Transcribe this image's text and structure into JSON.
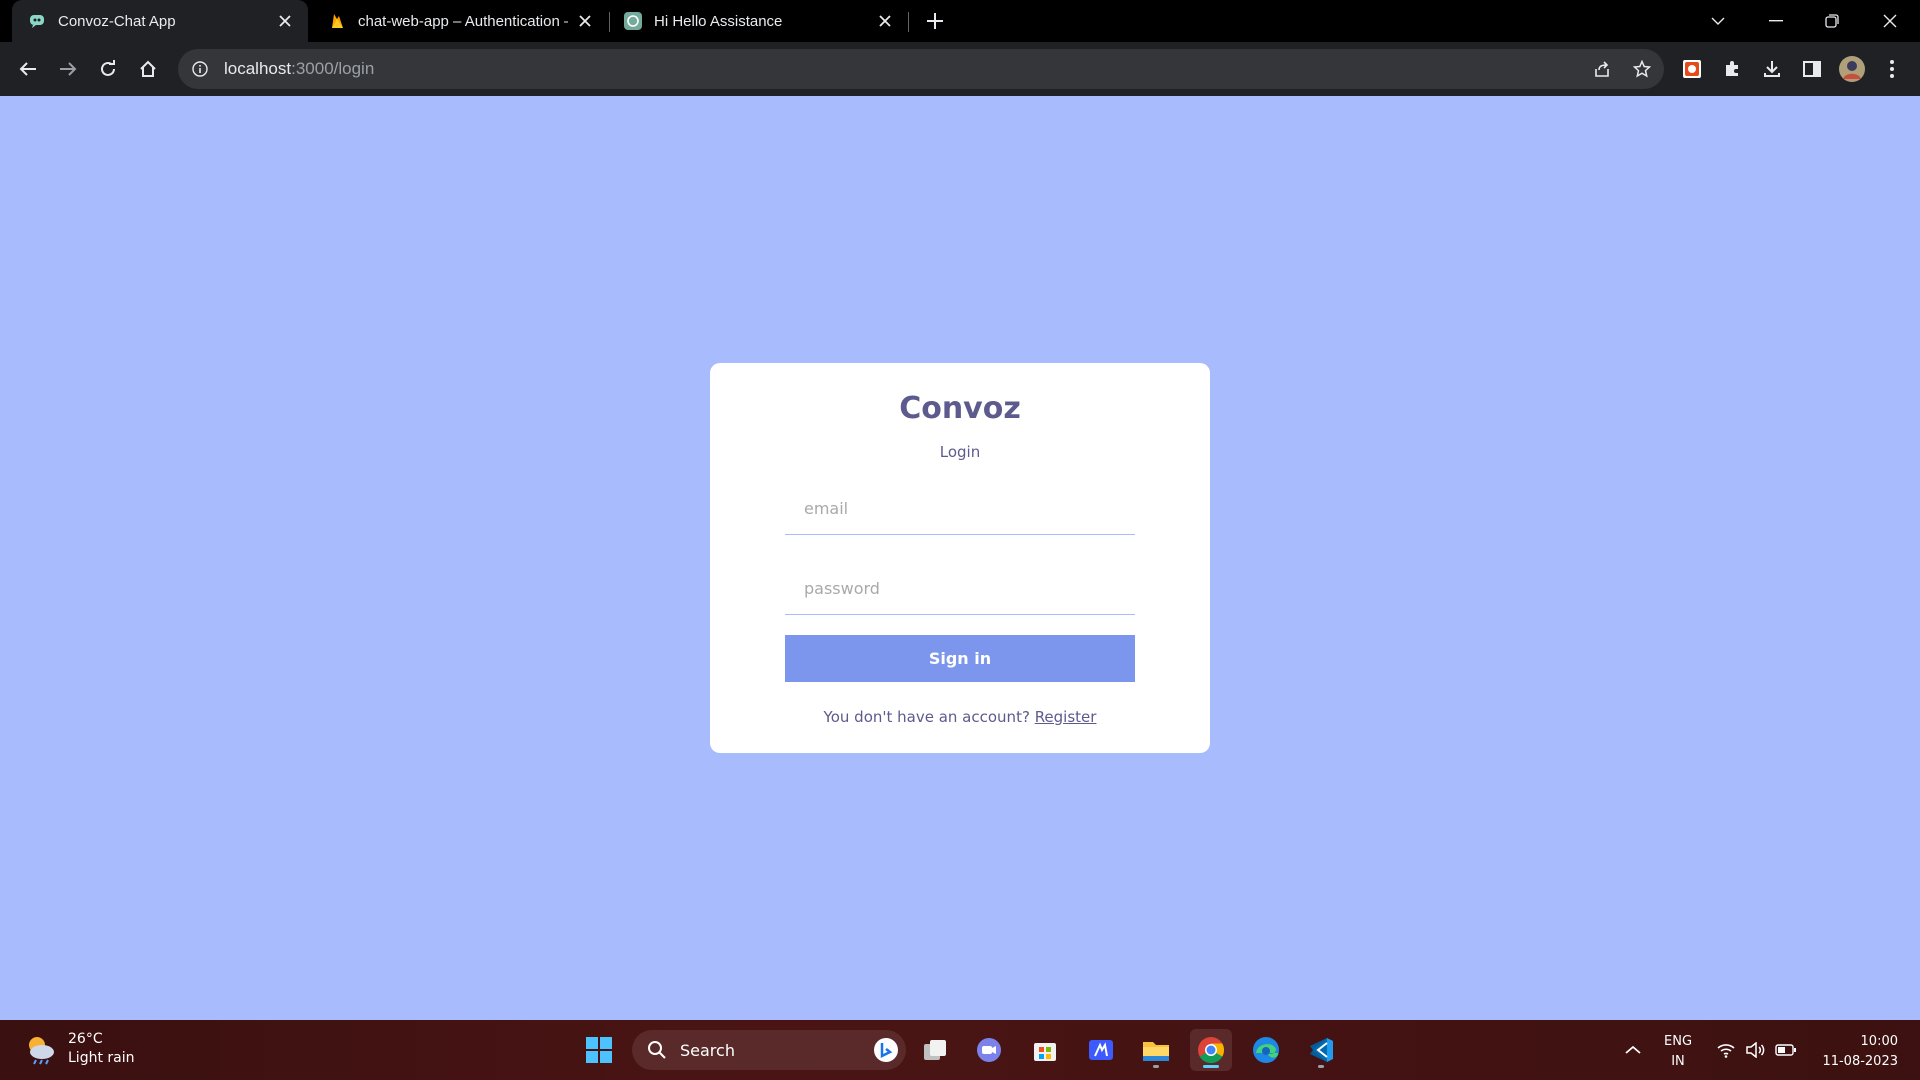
{
  "browser": {
    "tabs": [
      {
        "title": "Convoz-Chat App",
        "icon": "chat-bot-icon",
        "active": true
      },
      {
        "title": "chat-web-app – Authentication –",
        "icon": "firebase-icon",
        "active": false
      },
      {
        "title": "Hi Hello Assistance",
        "icon": "openai-icon",
        "active": false
      }
    ],
    "url_host": "localhost",
    "url_path": ":3000/login"
  },
  "page": {
    "background": "#a8bbfc",
    "brand": "Convoz",
    "subtitle": "Login",
    "email_placeholder": "email",
    "password_placeholder": "password",
    "signin_label": "Sign in",
    "footer_prefix": "You don't have an account? ",
    "register_label": "Register",
    "accent": "#7b96ec",
    "text_color": "#5d5b8d"
  },
  "taskbar": {
    "temperature": "26°C",
    "weather": "Light rain",
    "search_label": "Search",
    "lang_line1": "ENG",
    "lang_line2": "IN",
    "time": "10:00",
    "date": "11-08-2023"
  }
}
